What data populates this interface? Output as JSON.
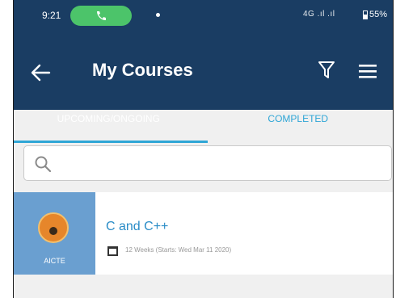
{
  "status_bar": {
    "time": "9:21",
    "network": "4G .ıl .ıl",
    "battery": "55%"
  },
  "app_bar": {
    "title": "My Courses",
    "tabs": [
      {
        "label": "UPCOMING/ONGOING",
        "active": true
      },
      {
        "label": "COMPLETED",
        "active": false
      }
    ]
  },
  "search": {
    "placeholder": "",
    "value": ""
  },
  "courses": [
    {
      "provider": "AICTE",
      "title": "C and C++",
      "meta": "12 Weeks (Starts: Wed Mar 11 2020)"
    }
  ],
  "colors": {
    "header_bg": "#1a3d63",
    "accent": "#2fa6d6",
    "call_pill": "#4cc46a",
    "thumb_bg": "#6a9fd0"
  },
  "icons": [
    "back-arrow-icon",
    "filter-icon",
    "menu-icon",
    "search-icon",
    "calendar-icon",
    "phone-icon"
  ]
}
